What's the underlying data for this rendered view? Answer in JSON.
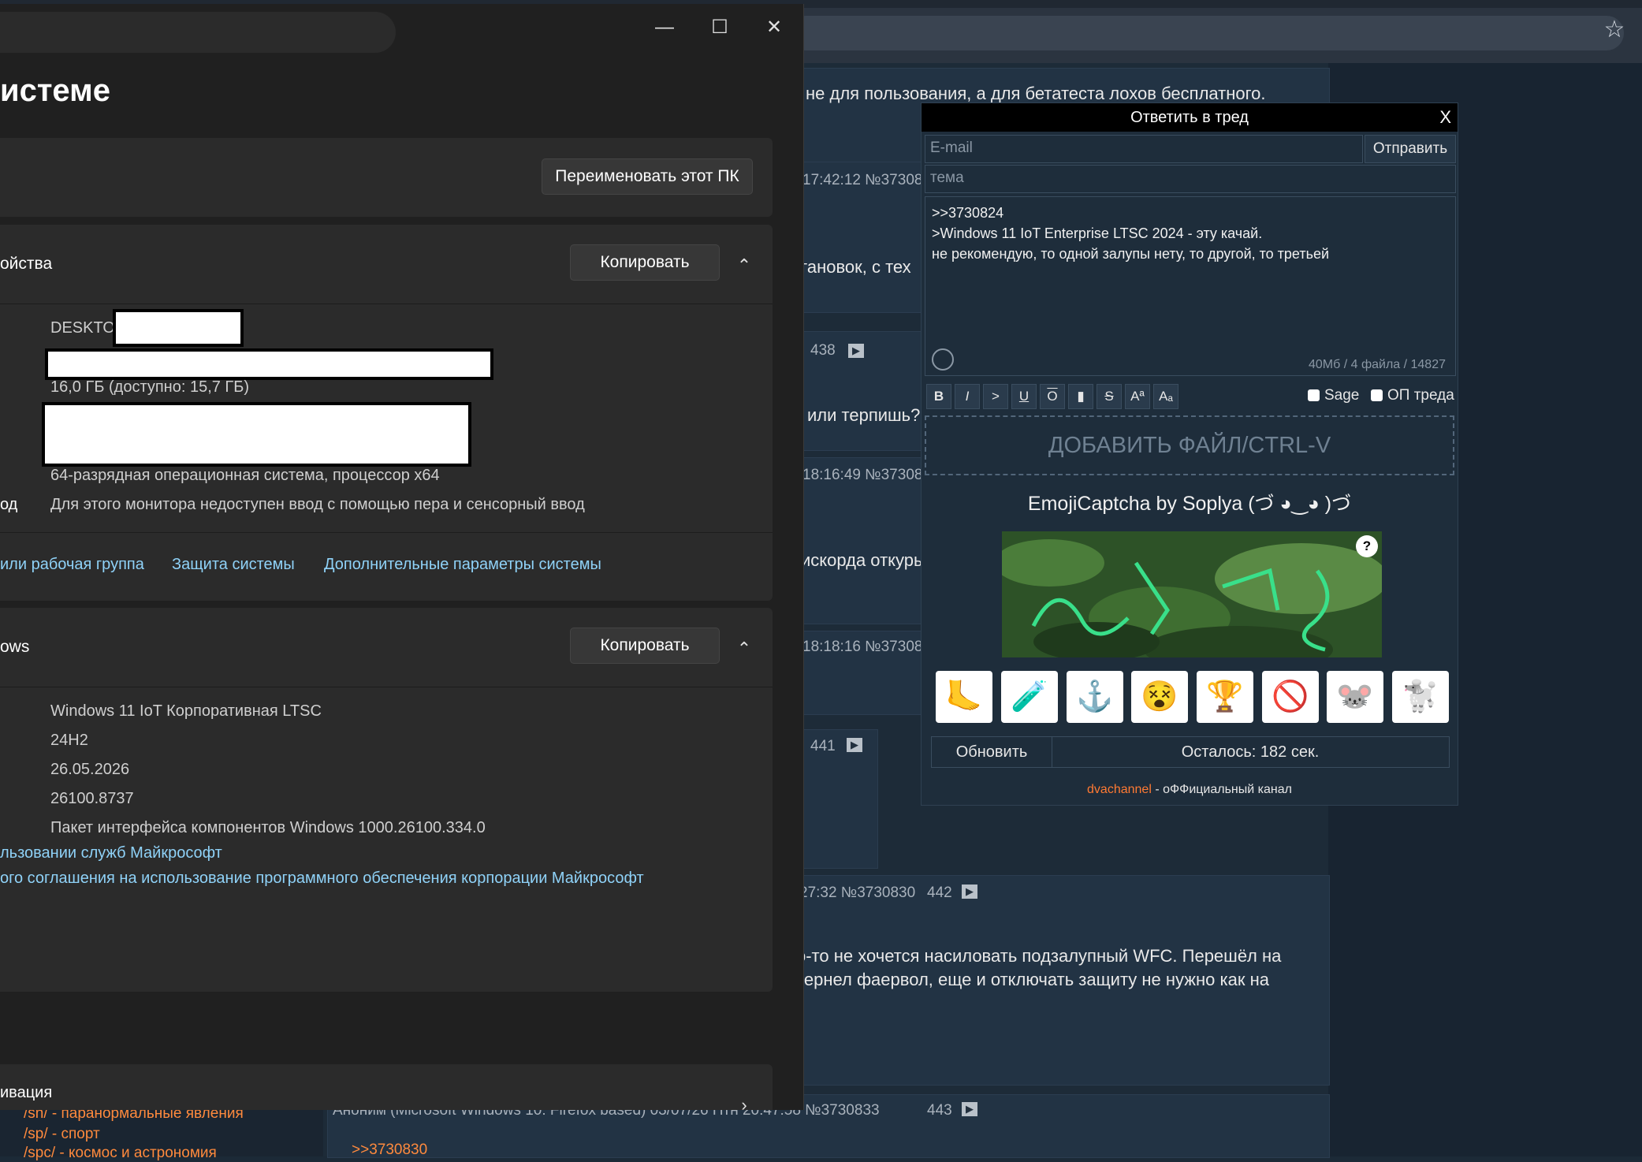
{
  "browser": {
    "bookmark_icon": "star-icon"
  },
  "board": {
    "posts": [
      {
        "text": "не для пользования, а для бетатеста лохов бесплатного."
      },
      {
        "meta": "17:42:12 №37308"
      },
      {
        "text": "тановок, с тех"
      },
      {
        "num": "438"
      },
      {
        "text": "или терпишь?"
      },
      {
        "meta": "18:16:49 №37308"
      },
      {
        "text": "искорда откуры"
      },
      {
        "meta": "18:18:16 №37308"
      },
      {
        "num": "441"
      },
      {
        "meta": "27:32 №3730830",
        "num": "442"
      },
      {
        "text": "о-то не хочется насиловать подзалупный WFC. Перешёл на"
      },
      {
        "text": "кернел фаервол, еще и отключать защиту не нужно как на"
      },
      {
        "meta": "Аноним (Microsoft Windows 10: Firefox based) 03/07/26 Птн 20:47:58 №3730833",
        "num": "443"
      },
      {
        "reply_link": ">>3730830"
      }
    ],
    "sidebar": [
      "/sn/ - паранормальные явления",
      "/sp/ - спорт",
      "/spc/ - космос и астрономия"
    ]
  },
  "reply_form": {
    "title": "Ответить в тред",
    "close": "X",
    "email_placeholder": "E-mail",
    "send": "Отправить",
    "subject_placeholder": "тема",
    "message_lines": [
      ">>3730824",
      ">Windows 11 IoT Enterprise LTSC 2024 - эту качай.",
      "не рекомендую, то одной залупы нету, то другой, то третьей"
    ],
    "counter": "40Мб / 4 файла / 14827",
    "format_buttons": [
      "B",
      "I",
      ">",
      "U",
      "O",
      "▮",
      "S",
      "Aª",
      "Aₐ"
    ],
    "sage": "Sage",
    "op": "ОП треда",
    "dropzone": "ДОБАВИТЬ ФАЙЛ/CTRL-V",
    "captcha_title": "EmojiCaptcha by Soplya (づ ◕‿◕ )づ",
    "captcha_help": "?",
    "emoji_options": [
      "🦶",
      "🧪",
      "⚓",
      "😵",
      "🏆",
      "🚫",
      "🐭",
      "🐩"
    ],
    "refresh": "Обновить",
    "remaining": "Осталось: 182 сек.",
    "footer_link": "dvachannel",
    "footer_text": " - оФФициальный канал"
  },
  "settings": {
    "controls": {
      "minimize": "—",
      "maximize": "☐",
      "close": "✕"
    },
    "page_title": "истеме",
    "rename_button": "Переименовать этот ПК",
    "device_section": "ойства",
    "copy_button": "Копировать",
    "device_name_prefix": "DESKTOI",
    "ram": "16,0 ГБ (доступно: 15,7 ГБ)",
    "system_type": "64-разрядная операционная система, процессор x64",
    "pen_label": "од",
    "pen_value": "Для этого монитора недоступен ввод с помощью пера и сенсорный ввод",
    "links": [
      "или рабочая группа",
      "Защита системы",
      "Дополнительные параметры системы"
    ],
    "windows_section": "ows",
    "edition": "Windows 11 IoT Корпоративная LTSC",
    "version": "24H2",
    "install_date": "26.05.2026",
    "build": "26100.8737",
    "experience": "Пакет интерфейса компонентов Windows 1000.26100.334.0",
    "msa_link": "льзовании служб Майкрософт",
    "license_link": "ого соглашения на использование программного обеспечения корпорации Майкрософт",
    "activation": "ивация"
  }
}
